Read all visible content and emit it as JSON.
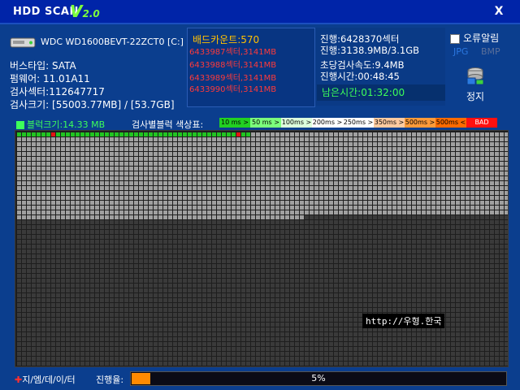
{
  "title": {
    "app_name": "HDD SCAN",
    "version_major": "V",
    "version_minor": "2.0",
    "close_label": "X"
  },
  "drive": {
    "model": "WDC WD1600BEVT-22ZCT0 [C:]",
    "bus_type": "버스타입: SATA",
    "firmware": "펌웨어: 11.01A11",
    "scan_sectors": "검사섹터:112647717",
    "scan_size": "검사크기: [55003.77MB] / [53.7GB]"
  },
  "bad": {
    "title": "배드카운트:570",
    "items": [
      "6433987섹터,3141MB",
      "6433988섹터,3141MB",
      "6433989섹터,3141MB",
      "6433990섹터,3141MB"
    ]
  },
  "progress_info": {
    "progress_sector": "진행:6428370섹터",
    "progress_size": "진행:3138.9MB/3.1GB",
    "speed": "초당검사속도:9.4MB",
    "elapsed": "진행시간:00:48:45",
    "remaining": "남은시간:01:32:00"
  },
  "options": {
    "error_log": "오류알림",
    "jpg": "JPG",
    "bmp": "BMP",
    "stop": "정지"
  },
  "legend": {
    "block_size": "블럭크기:14.33 MB",
    "label": "검사별블럭 색상표:",
    "items": [
      {
        "text": "10 ms >",
        "color": "#22d022"
      },
      {
        "text": "50 ms >",
        "color": "#7cff7c"
      },
      {
        "text": "100ms >",
        "color": "#dcffdc"
      },
      {
        "text": "200ms >",
        "color": "#ffffff"
      },
      {
        "text": "250ms >",
        "color": "#ffffff"
      },
      {
        "text": "350ms >",
        "color": "#ffcaa0"
      },
      {
        "text": "500ms >",
        "color": "#ff9a3a"
      },
      {
        "text": "500ms <",
        "color": "#ff6a00"
      },
      {
        "text": "BAD",
        "color": "#ff1010"
      }
    ]
  },
  "watermark": "http://우형.한국",
  "footer": {
    "brand": "지/엠/데/이/터",
    "progress_label": "진행율:",
    "progress_percent": 5,
    "progress_text": "5%"
  },
  "colors": {
    "block_scanned": "#a0a0a0",
    "block_pending": "#3a3a3a",
    "block_fast": "#21c521",
    "block_bad": "#e41414"
  }
}
